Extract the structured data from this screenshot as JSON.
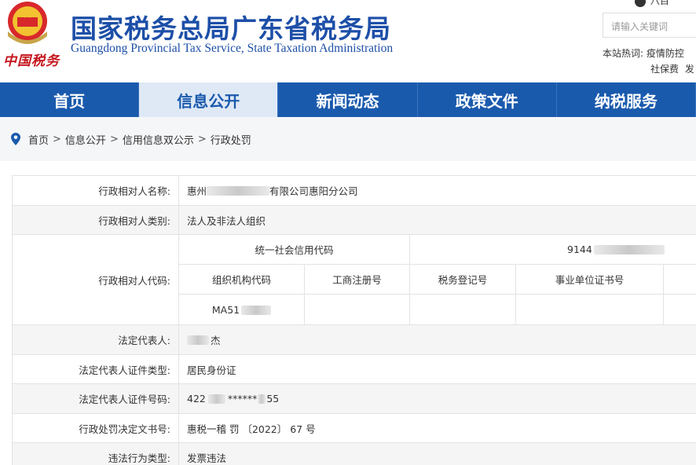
{
  "header": {
    "title_cn": "国家税务总局广东省税务局",
    "title_en": "Guangdong Provincial Tax Service, State Taxation Administration",
    "calligraphy": "中国税务",
    "top_link": "八目",
    "search_placeholder": "请输入关键词",
    "hot_label": "本站热词:",
    "hot_words_line1": [
      "疫情防控"
    ],
    "hot_words_line2": [
      "社保费",
      "发"
    ]
  },
  "nav": {
    "items": [
      {
        "label": "首页",
        "active": false
      },
      {
        "label": "信息公开",
        "active": true
      },
      {
        "label": "新闻动态",
        "active": false
      },
      {
        "label": "政策文件",
        "active": false
      },
      {
        "label": "纳税服务",
        "active": false
      }
    ]
  },
  "breadcrumb": [
    "首页",
    "信息公开",
    "信用信息双公示",
    "行政处罚"
  ],
  "breadcrumb_sep": ">",
  "detail": {
    "name_label": "行政相对人名称:",
    "name_prefix": "惠州",
    "name_suffix": "有限公司惠阳分公司",
    "type_label": "行政相对人类别:",
    "type_value": "法人及非法人组织",
    "code_label": "行政相对人代码:",
    "usc_header": "统一社会信用代码",
    "usc_value": "9144",
    "code_headers": [
      "组织机构代码",
      "工商注册号",
      "税务登记号",
      "事业单位证书号"
    ],
    "org_code_value": "MA51",
    "legal_rep_label": "法定代表人:",
    "legal_rep_value": "杰",
    "id_type_label": "法定代表人证件类型:",
    "id_type_value": "居民身份证",
    "id_no_label": "法定代表人证件号码:",
    "id_no_prefix": "422",
    "id_no_mid": "******",
    "id_no_suffix": "55",
    "decision_label": "行政处罚决定文书号:",
    "decision_value": "惠税一稽 罚 〔2022〕 67 号",
    "violation_label": "违法行为类型:",
    "violation_value": "发票违法"
  },
  "colors": {
    "brand_blue": "#1a5aad",
    "title_blue": "#1d4fa8",
    "active_nav_bg": "#dfe9f6",
    "seal_red": "#c4161c"
  }
}
